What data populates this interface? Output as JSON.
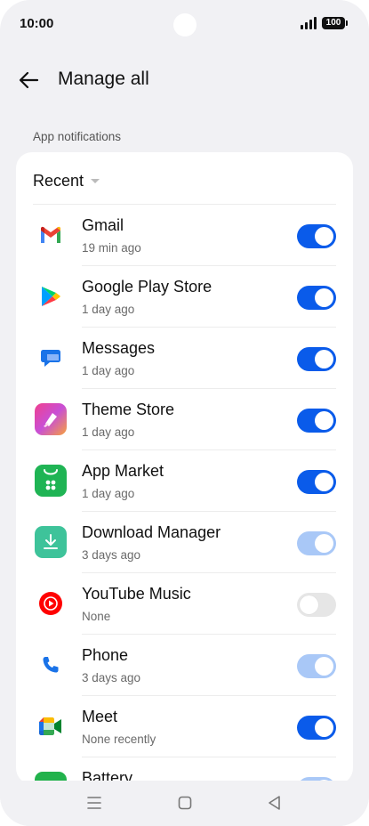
{
  "status_bar": {
    "time": "10:00",
    "battery": "100"
  },
  "header": {
    "title": "Manage all"
  },
  "section": {
    "label": "App notifications"
  },
  "filter": {
    "label": "Recent"
  },
  "apps": [
    {
      "name": "Gmail",
      "sub": "19 min ago",
      "state": "on",
      "icon": "gmail-icon"
    },
    {
      "name": "Google Play Store",
      "sub": "1 day ago",
      "state": "on",
      "icon": "google-play-store-icon"
    },
    {
      "name": "Messages",
      "sub": "1 day ago",
      "state": "on",
      "icon": "messages-icon"
    },
    {
      "name": "Theme Store",
      "sub": "1 day ago",
      "state": "on",
      "icon": "theme-store-icon"
    },
    {
      "name": "App Market",
      "sub": "1 day ago",
      "state": "on",
      "icon": "app-market-icon"
    },
    {
      "name": "Download Manager",
      "sub": "3 days ago",
      "state": "on-dim",
      "icon": "download-manager-icon"
    },
    {
      "name": "YouTube Music",
      "sub": "None",
      "state": "off",
      "icon": "youtube-music-icon"
    },
    {
      "name": "Phone",
      "sub": "3 days ago",
      "state": "on-dim",
      "icon": "phone-icon"
    },
    {
      "name": "Meet",
      "sub": "None recently",
      "state": "on",
      "icon": "meet-icon"
    },
    {
      "name": "Battery",
      "sub": "",
      "state": "on-dim",
      "icon": "battery-app-icon"
    }
  ],
  "colors": {
    "accent": "#0a5bea",
    "accent_disabled": "#a9c8f7",
    "toggle_off": "#e6e6e6",
    "background": "#f1f1f4"
  }
}
